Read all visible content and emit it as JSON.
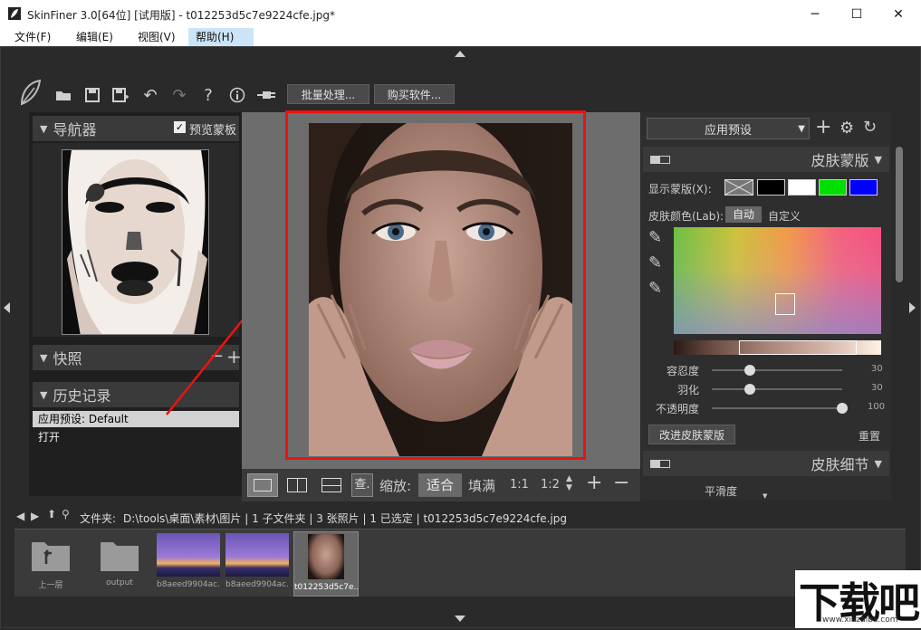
{
  "window": {
    "title": "SkinFiner 3.0[64位] [试用版] - t012253d5c7e9224cfe.jpg*",
    "minimize": "─",
    "maximize": "☐",
    "close": "✕"
  },
  "menu": {
    "file": "文件(F)",
    "edit": "编辑(E)",
    "view": "视图(V)",
    "help": "帮助(H)"
  },
  "toolbar": {
    "batch": "批量处理...",
    "buy": "购买软件..."
  },
  "navigator": {
    "title": "导航器",
    "preview_mask": "预览蒙板"
  },
  "snapshot": {
    "title": "快照",
    "minus": "−",
    "plus": "+"
  },
  "history": {
    "title": "历史记录",
    "items": [
      "应用预设: Default",
      "打开"
    ]
  },
  "zoom": {
    "label": "缩放:",
    "fit": "适合",
    "fill": "填满",
    "r11": "1:1",
    "r12": "1:2",
    "plus": "+",
    "minus": "−",
    "check": "查."
  },
  "right": {
    "preset": "应用预设",
    "skin_mask_title": "皮肤蒙版",
    "show_mask": "显示蒙版(X):",
    "skin_color": "皮肤颜色(Lab):",
    "auto": "自动",
    "custom": "自定义",
    "improve": "改进皮肤蒙版",
    "reset": "重置",
    "skin_detail_title": "皮肤细节",
    "smoothness": "平滑度",
    "sliders": [
      {
        "label": "容忍度",
        "value": "30"
      },
      {
        "label": "羽化",
        "value": "30"
      },
      {
        "label": "不透明度",
        "value": "100"
      }
    ],
    "mask_swatches": [
      "#000000",
      "#ffffff",
      "#00e000",
      "#0000ff"
    ]
  },
  "filebar": {
    "label": "文件夹:",
    "path": "D:\\tools\\桌面\\素材\\图片 | 1 子文件夹 | 3 张照片 | 1 已选定 | t012253d5c7e9224cfe.jpg"
  },
  "thumbs": [
    {
      "caption": "上一层"
    },
    {
      "caption": "output"
    },
    {
      "caption": "b8aeed9904ac..."
    },
    {
      "caption": "b8aeed9904ac..."
    },
    {
      "caption": "t012253d5c7e..."
    }
  ],
  "watermark": {
    "big": "下载吧",
    "small": "www.xiazaiba.com"
  }
}
